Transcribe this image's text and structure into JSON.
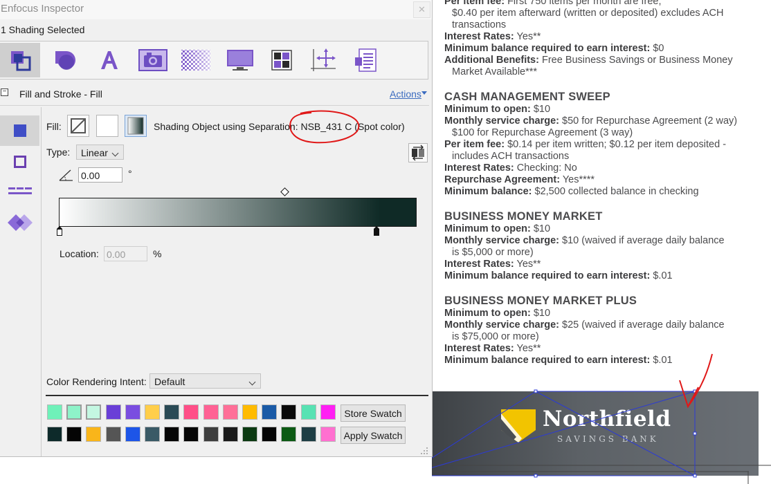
{
  "document": {
    "lines": [
      {
        "bold": "Per item fee:",
        "rest": " First 750 items per month are free;",
        "indent": false
      },
      {
        "bold": "",
        "rest": "$0.40 per item afterward (written or deposited) excludes ACH",
        "indent": true
      },
      {
        "bold": "",
        "rest": "transactions",
        "indent": true
      },
      {
        "bold": "Interest Rates:",
        "rest": " Yes**",
        "indent": false
      },
      {
        "bold": "Minimum balance required to earn interest:",
        "rest": " $0",
        "indent": false
      },
      {
        "bold": "Additional Benefits:",
        "rest": " Free Business Savings or Business Money",
        "indent": false
      },
      {
        "bold": "",
        "rest": "Market Available***",
        "indent": true
      }
    ],
    "sections": [
      {
        "heading": "CASH MANAGEMENT SWEEP",
        "lines": [
          {
            "bold": "Minimum to open:",
            "rest": " $10",
            "indent": false
          },
          {
            "bold": "Monthly service charge:",
            "rest": " $50 for Repurchase Agreement (2 way)",
            "indent": false
          },
          {
            "bold": "",
            "rest": "$100 for Repurchase Agreement (3 way)",
            "indent": true
          },
          {
            "bold": "Per item fee:",
            "rest": " $0.14 per item written; $0.12 per item deposited -",
            "indent": false
          },
          {
            "bold": "",
            "rest": "includes ACH transactions",
            "indent": true
          },
          {
            "bold": "Interest Rates:",
            "rest": " Checking: No",
            "indent": false
          },
          {
            "bold": "Repurchase Agreement:",
            "rest": " Yes****",
            "indent": false
          },
          {
            "bold": "Minimum balance:",
            "rest": " $2,500 collected balance in checking",
            "indent": false
          }
        ]
      },
      {
        "heading": "BUSINESS MONEY MARKET",
        "lines": [
          {
            "bold": "Minimum to open:",
            "rest": " $10",
            "indent": false
          },
          {
            "bold": "Monthly service charge:",
            "rest": " $10 (waived if average daily balance",
            "indent": false
          },
          {
            "bold": "",
            "rest": "is $5,000 or more)",
            "indent": true
          },
          {
            "bold": "Interest Rates:",
            "rest": " Yes**",
            "indent": false
          },
          {
            "bold": "Minimum balance required to earn interest:",
            "rest": " $.01",
            "indent": false
          }
        ]
      },
      {
        "heading": "BUSINESS MONEY MARKET PLUS",
        "lines": [
          {
            "bold": "Minimum to open:",
            "rest": " $10",
            "indent": false
          },
          {
            "bold": "Monthly service charge:",
            "rest": " $25 (waived if average daily balance",
            "indent": false
          },
          {
            "bold": "",
            "rest": "is $75,000 or more)",
            "indent": true
          },
          {
            "bold": "Interest Rates:",
            "rest": " Yes**",
            "indent": false
          },
          {
            "bold": "Minimum balance required to earn interest:",
            "rest": " $.01",
            "indent": false
          }
        ]
      }
    ],
    "logo": {
      "name": "Northfield",
      "subname": "SAVINGS BANK"
    }
  },
  "inspector": {
    "title": "Enfocus Inspector",
    "subtitle": "1 Shading Selected",
    "toolbar": [
      {
        "icon": "fill-stroke-icon",
        "active": true
      },
      {
        "icon": "shape-icon",
        "active": false
      },
      {
        "icon": "text-icon",
        "active": false
      },
      {
        "icon": "image-icon",
        "active": false
      },
      {
        "icon": "transparency-icon",
        "active": false
      },
      {
        "icon": "monitor-icon",
        "active": false
      },
      {
        "icon": "grid-icon",
        "active": false
      },
      {
        "icon": "position-icon",
        "active": false
      },
      {
        "icon": "document-icon",
        "active": false
      }
    ],
    "section_title": "Fill and Stroke - Fill",
    "actions_label": "Actions",
    "fill": {
      "label": "Fill:",
      "description": "Shading Object using Separation: NSB_431 C (Spot color)"
    },
    "type": {
      "label": "Type:",
      "value": "Linear"
    },
    "angle": {
      "value": "0.00",
      "unit": "°"
    },
    "gradient": {
      "start_color": "#ffffff",
      "end_color": "#0f2a26"
    },
    "location": {
      "label": "Location:",
      "value": "0.00",
      "unit": "%"
    },
    "rendering_intent": {
      "label": "Color Rendering Intent:",
      "value": "Default"
    },
    "palette": {
      "row1": [
        "#6ff1b9",
        "#8ef3c9",
        "#c4f7e2",
        "#6a3fd7",
        "#7a4de0",
        "#ffce4a",
        "#2a4a55",
        "#ff4f88",
        "#ff6194",
        "#ff6f98",
        "#ffbb00",
        "#1a5aa6",
        "#0a0a0a",
        "#58e2b3",
        "#ff1ff3"
      ],
      "row2": [
        "#0d2a2a",
        "#050505",
        "#f9b51a",
        "#555555",
        "#1d55e8",
        "#3a5a66",
        "#050505",
        "#050505",
        "#3e3e3e",
        "#1a1a1a",
        "#0c3a12",
        "#050505",
        "#0c5a14",
        "#1e3e44",
        "#ff70d0"
      ],
      "selected_row1": [
        1,
        2
      ]
    },
    "store_button": "Store Swatch",
    "apply_button": "Apply Swatch"
  }
}
